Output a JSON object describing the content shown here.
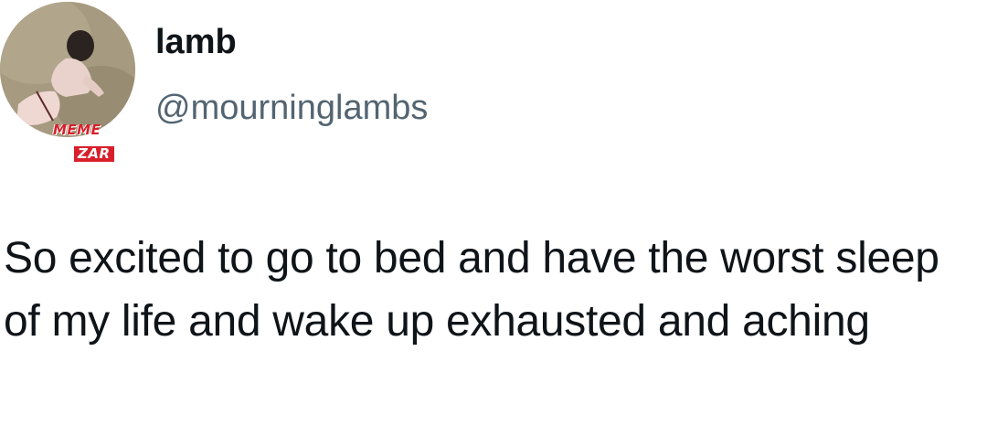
{
  "author": {
    "display_name": "lamb",
    "handle": "@mourninglambs",
    "avatar_icon": "avatar-photo-icon"
  },
  "watermark": {
    "line1": "MEME",
    "line2": "ZAR",
    "color": "#d8202a"
  },
  "tweet": {
    "text": "So excited to go to bed and have the worst sleep of my life and wake up exhausted and aching"
  },
  "colors": {
    "text_primary": "#0f1419",
    "text_secondary": "#536471",
    "background": "#ffffff"
  }
}
